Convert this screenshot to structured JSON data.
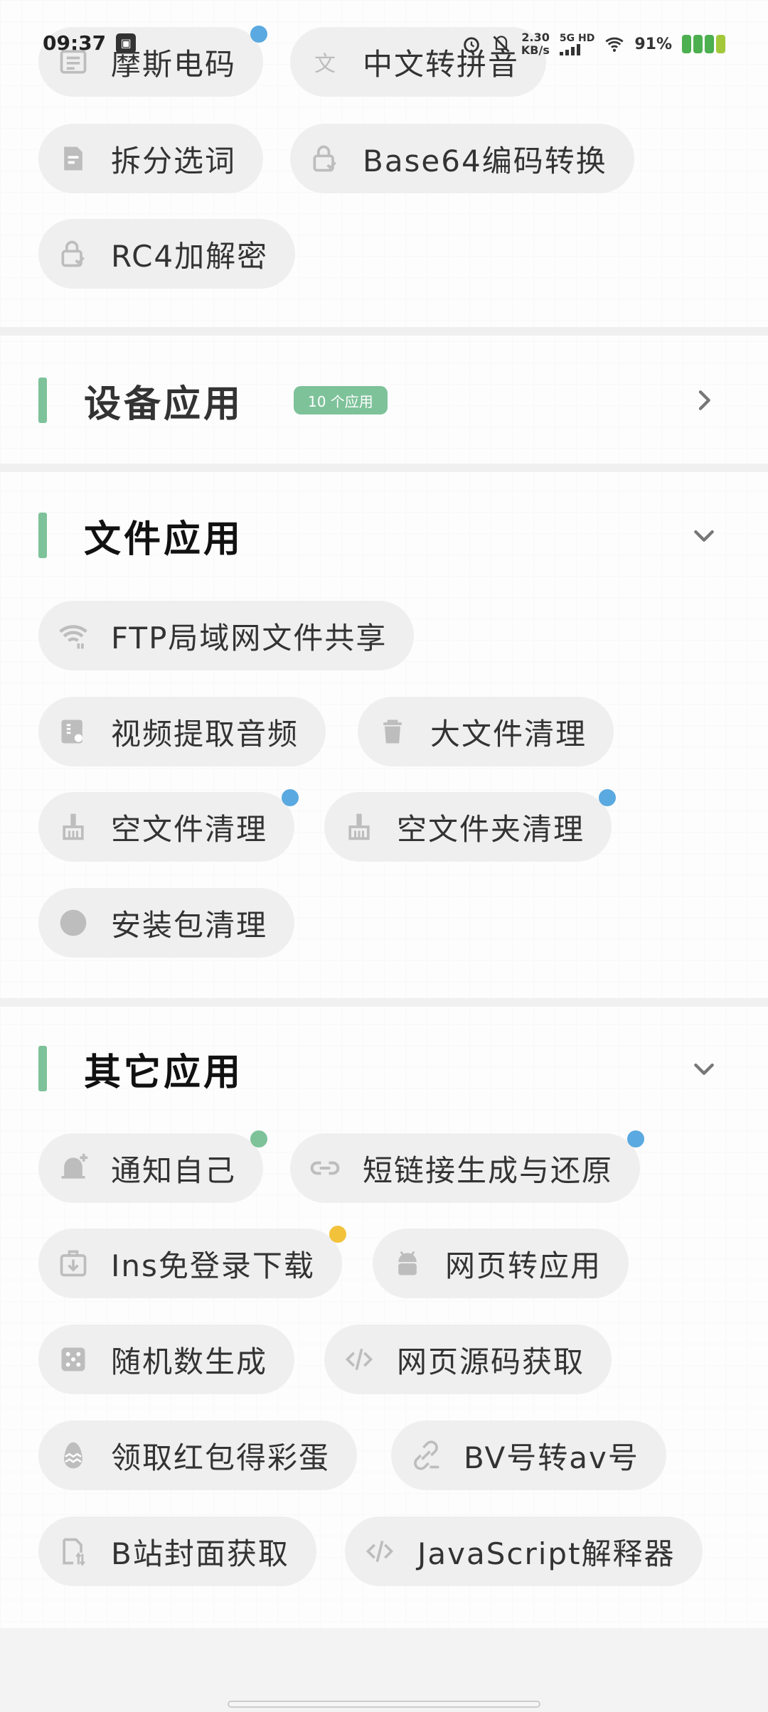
{
  "status_bar": {
    "time": "09:37",
    "net_speed_value": "2.30",
    "net_speed_unit": "KB/s",
    "network_type": "5G HD",
    "battery": "91%"
  },
  "top_section": {
    "chips": [
      {
        "label": "摩斯电码",
        "icon": "list-icon"
      },
      {
        "label": "中文转拼音",
        "icon": "translate-icon"
      },
      {
        "label": "拆分选词",
        "icon": "doc-edit-icon"
      },
      {
        "label": "Base64编码转换",
        "icon": "lock-check-icon"
      },
      {
        "label": "RC4加解密",
        "icon": "lock-check-icon"
      }
    ]
  },
  "device_section": {
    "title": "设备应用",
    "badge": "10 个应用"
  },
  "file_section": {
    "title": "文件应用",
    "chips": [
      {
        "label": "FTP局域网文件共享",
        "icon": "wifi-icon"
      },
      {
        "label": "视频提取音频",
        "icon": "video-audio-icon"
      },
      {
        "label": "大文件清理",
        "icon": "trash-icon"
      },
      {
        "label": "空文件清理",
        "icon": "broom-icon"
      },
      {
        "label": "空文件夹清理",
        "icon": "broom-icon"
      },
      {
        "label": "安装包清理",
        "icon": "circle-icon"
      }
    ]
  },
  "other_section": {
    "title": "其它应用",
    "chips": [
      {
        "label": "通知自己",
        "icon": "bell-add-icon"
      },
      {
        "label": "短链接生成与还原",
        "icon": "link-icon"
      },
      {
        "label": "Ins免登录下载",
        "icon": "download-box-icon"
      },
      {
        "label": "网页转应用",
        "icon": "android-icon"
      },
      {
        "label": "随机数生成",
        "icon": "dice-icon"
      },
      {
        "label": "网页源码获取",
        "icon": "code-icon"
      },
      {
        "label": "领取红包得彩蛋",
        "icon": "egg-icon"
      },
      {
        "label": "BV号转av号",
        "icon": "link-edit-icon"
      },
      {
        "label": "B站封面获取",
        "icon": "file-swap-icon"
      },
      {
        "label": "JavaScript解释器",
        "icon": "code-icon"
      }
    ]
  },
  "colors": {
    "accent_green": "#7ec29a",
    "dot_blue": "#5aa9e0",
    "dot_green": "#7ec29a",
    "dot_yellow": "#f2c23a",
    "chip_bg": "#efefef"
  }
}
